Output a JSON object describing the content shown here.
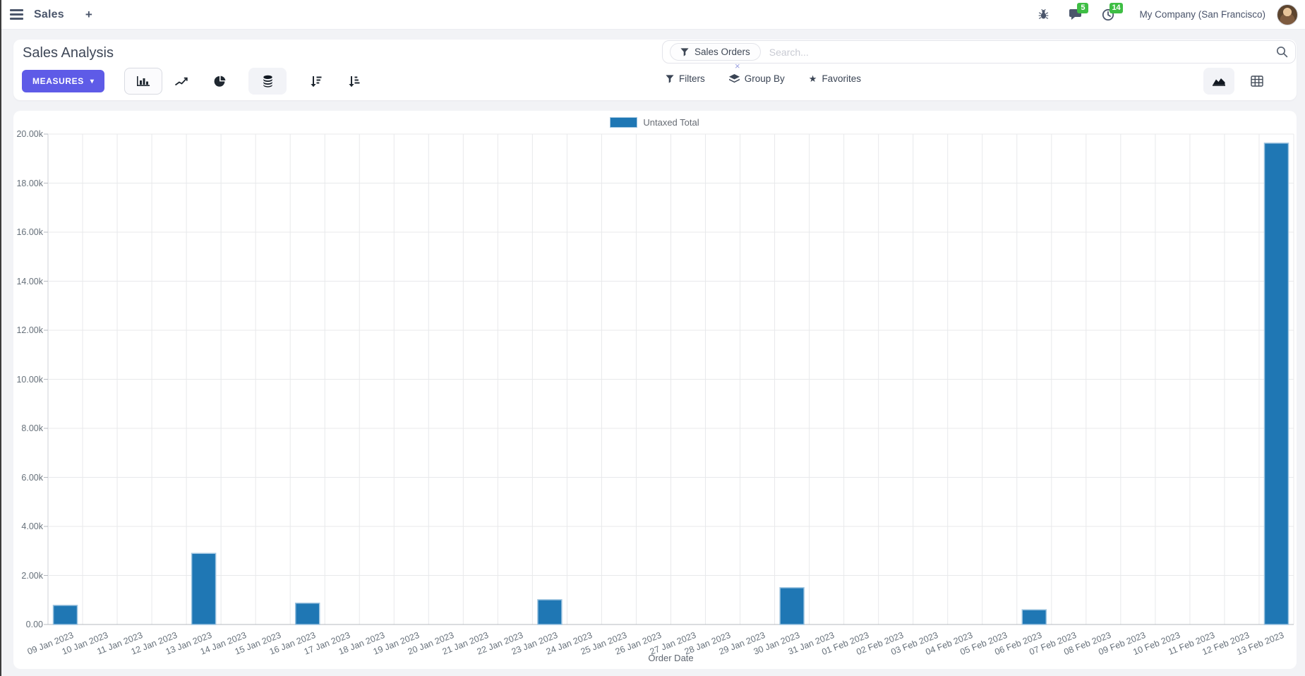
{
  "navbar": {
    "menu_label": "Sales",
    "plus_label": "+",
    "messages_badge": "5",
    "activities_badge": "14",
    "company": "My Company (San Francisco)"
  },
  "control_panel": {
    "title": "Sales Analysis",
    "measures_label": "MEASURES",
    "measures_caret": "▾",
    "search": {
      "facet": "Sales Orders",
      "facet_remove": "×",
      "placeholder": "Search..."
    },
    "filters_label": "Filters",
    "group_by_label": "Group By",
    "favorites_label": "Favorites"
  },
  "colors": {
    "accent": "#5e5be7",
    "bar": "#1f77b4",
    "bar_border": "#9dc4e0",
    "badge_green": "#3ebe44",
    "grid": "#e8e9eb",
    "axis": "#b5b9bf"
  },
  "chart_data": {
    "type": "bar",
    "title": "",
    "xlabel": "Order Date",
    "ylabel": "",
    "ylim": [
      0,
      20000
    ],
    "ytick_step": 2000,
    "grid": true,
    "legend_position": "top",
    "legend": [
      "Untaxed Total"
    ],
    "series_name": "Untaxed Total",
    "categories": [
      "09 Jan 2023",
      "10 Jan 2023",
      "11 Jan 2023",
      "12 Jan 2023",
      "13 Jan 2023",
      "14 Jan 2023",
      "15 Jan 2023",
      "16 Jan 2023",
      "17 Jan 2023",
      "18 Jan 2023",
      "19 Jan 2023",
      "20 Jan 2023",
      "21 Jan 2023",
      "22 Jan 2023",
      "23 Jan 2023",
      "24 Jan 2023",
      "25 Jan 2023",
      "26 Jan 2023",
      "27 Jan 2023",
      "28 Jan 2023",
      "29 Jan 2023",
      "30 Jan 2023",
      "31 Jan 2023",
      "01 Feb 2023",
      "02 Feb 2023",
      "03 Feb 2023",
      "04 Feb 2023",
      "05 Feb 2023",
      "06 Feb 2023",
      "07 Feb 2023",
      "08 Feb 2023",
      "09 Feb 2023",
      "10 Feb 2023",
      "11 Feb 2023",
      "12 Feb 2023",
      "13 Feb 2023"
    ],
    "values": [
      780,
      0,
      0,
      0,
      2900,
      0,
      0,
      870,
      0,
      0,
      0,
      0,
      0,
      0,
      1010,
      0,
      0,
      0,
      0,
      0,
      0,
      1500,
      0,
      0,
      0,
      0,
      0,
      0,
      600,
      0,
      0,
      0,
      0,
      0,
      0,
      19630
    ]
  }
}
